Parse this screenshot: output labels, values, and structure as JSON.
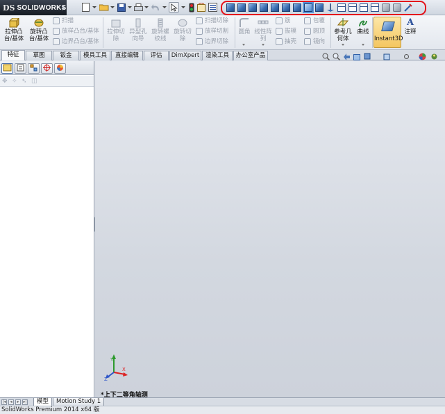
{
  "app": {
    "logo_text": "SOLIDWORKS",
    "logo_mark": "DS"
  },
  "quick_access": {
    "icons": [
      "new-document-icon",
      "open-icon",
      "save-icon",
      "print-icon",
      "undo-icon",
      "select-icon",
      "rebuild-icon",
      "file-properties-icon",
      "options-icon"
    ]
  },
  "view_orientation_toolbar": {
    "highlight_color": "#e4141c",
    "icons": [
      "front-view-icon",
      "back-view-icon",
      "left-view-icon",
      "right-view-icon",
      "top-view-icon",
      "bottom-view-icon",
      "isometric-view-icon",
      "trimetric-view-icon",
      "dimetric-view-icon",
      "normal-to-icon",
      "single-view-icon",
      "two-view-horizontal-icon",
      "two-view-vertical-icon",
      "four-view-icon",
      "link-views-icon",
      "view-selector-icon",
      "hide-show-icon"
    ]
  },
  "ribbon": {
    "extruded_boss": "拉伸凸台/基体",
    "revolved_boss": "旋转凸台/基体",
    "swept_boss": "扫描",
    "lofted_boss": "放样凸台/基体",
    "boundary_boss": "边界凸台/基体",
    "extruded_cut": "拉伸切除",
    "hole_wizard": "异型孔向导",
    "revolved_thread": "旋转螺纹线",
    "revolved_cut": "旋转切除",
    "swept_cut": "扫描切除",
    "lofted_cut": "放样切割",
    "boundary_cut": "边界切除",
    "fillet": "圆角",
    "linear_pattern": "线性阵列",
    "rib": "筋",
    "draft": "拔模",
    "shell": "抽壳",
    "wrap": "包覆",
    "dome": "圆顶",
    "mirror": "镜向",
    "ref_geometry": "参考几何体",
    "curves": "曲线",
    "instant3d": "Instant3D",
    "annotation": "注释"
  },
  "command_tabs": [
    "特征",
    "草图",
    "钣金",
    "模具工具",
    "直接编辑",
    "评估",
    "DimXpert",
    "渲染工具",
    "办公室产品"
  ],
  "active_command_tab": "特征",
  "left_panel": {
    "tabs": [
      "feature-manager-icon",
      "property-manager-icon",
      "configuration-manager-icon",
      "dimxpert-manager-icon",
      "display-manager-icon"
    ]
  },
  "graphics": {
    "view_name": "*上下二等角轴测",
    "triad_labels": {
      "x": "X",
      "y": "Y",
      "z": "Z"
    }
  },
  "bottom_tabs": [
    "模型",
    "Motion Study 1"
  ],
  "active_bottom_tab": "模型",
  "status": {
    "text": "SolidWorks Premium 2014 x64 版"
  }
}
